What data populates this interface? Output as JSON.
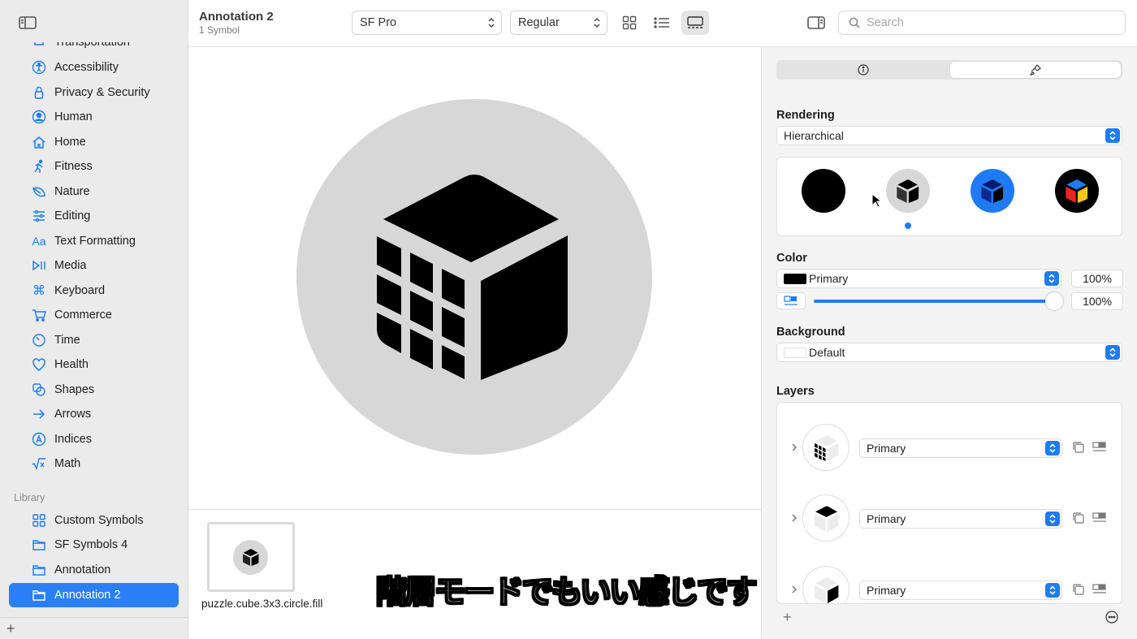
{
  "sidebar": {
    "categories": [
      {
        "label": "Transportation",
        "icon": "car-icon"
      },
      {
        "label": "Accessibility",
        "icon": "accessibility-icon"
      },
      {
        "label": "Privacy & Security",
        "icon": "lock-icon"
      },
      {
        "label": "Human",
        "icon": "person-circle-icon"
      },
      {
        "label": "Home",
        "icon": "house-icon"
      },
      {
        "label": "Fitness",
        "icon": "runner-icon"
      },
      {
        "label": "Nature",
        "icon": "leaf-icon"
      },
      {
        "label": "Editing",
        "icon": "sliders-icon"
      },
      {
        "label": "Text Formatting",
        "icon": "text-format-icon"
      },
      {
        "label": "Media",
        "icon": "play-pause-icon"
      },
      {
        "label": "Keyboard",
        "icon": "command-icon"
      },
      {
        "label": "Commerce",
        "icon": "cart-icon"
      },
      {
        "label": "Time",
        "icon": "timer-icon"
      },
      {
        "label": "Health",
        "icon": "heart-icon"
      },
      {
        "label": "Shapes",
        "icon": "shapes-icon"
      },
      {
        "label": "Arrows",
        "icon": "arrow-right-icon"
      },
      {
        "label": "Indices",
        "icon": "letter-a-circle-icon"
      },
      {
        "label": "Math",
        "icon": "square-root-icon"
      }
    ],
    "library_title": "Library",
    "library": [
      {
        "label": "Custom Symbols",
        "icon": "grid-icon"
      },
      {
        "label": "SF Symbols 4",
        "icon": "folder-icon"
      },
      {
        "label": "Annotation",
        "icon": "folder-icon"
      },
      {
        "label": "Annotation 2",
        "icon": "folder-icon",
        "selected": true
      }
    ]
  },
  "toolbar": {
    "title": "Annotation 2",
    "subtitle": "1 Symbol",
    "font_family": "SF Pro",
    "font_weight": "Regular",
    "search_placeholder": "Search"
  },
  "gallery": {
    "symbol_name": "puzzle.cube.3x3.circle.fill"
  },
  "caption": "階層モードでもいい感じです",
  "inspector": {
    "rendering_title": "Rendering",
    "rendering_mode": "Hierarchical",
    "color_title": "Color",
    "color_value": "Primary",
    "color_opacity": "100%",
    "slider_value": "100%",
    "background_title": "Background",
    "background_value": "Default",
    "layers_title": "Layers",
    "layers": [
      {
        "value": "Primary"
      },
      {
        "value": "Primary"
      },
      {
        "value": "Primary"
      }
    ]
  },
  "colors": {
    "accent": "#1f7bf4",
    "sidebar_bg": "#ebebeb",
    "symbol_bg": "#d7d7d7"
  }
}
